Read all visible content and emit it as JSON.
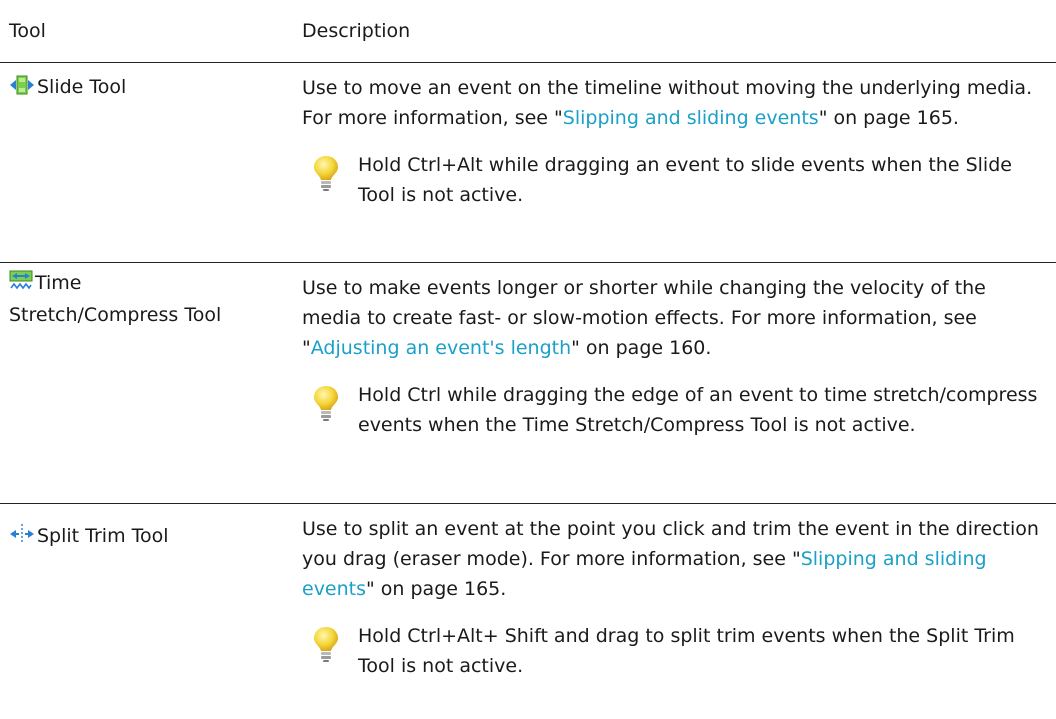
{
  "header": {
    "tool": "Tool",
    "description": "Description"
  },
  "rows": [
    {
      "tool_name": "Slide Tool",
      "icon": "slide-tool-icon",
      "desc_before": "Use to move an event on the timeline without moving the underlying media. For more information, see \"",
      "link_text": "Slipping and sliding events",
      "desc_after": "\" on page 165.",
      "tip": "Hold Ctrl+Alt while dragging an event to slide events when the Slide Tool is not active."
    },
    {
      "tool_name_line1": "Time",
      "tool_name_line2": "Stretch/Compress Tool",
      "icon": "time-stretch-tool-icon",
      "desc_before": "Use to make events longer or shorter while changing the velocity of the media to create fast- or slow-motion effects. For more information, see \"",
      "link_text": "Adjusting an event's length",
      "desc_after": "\" on page 160.",
      "tip": "Hold Ctrl while dragging the edge of an event to time stretch/compress events when the Time Stretch/Compress Tool is not active."
    },
    {
      "tool_name": "Split Trim Tool",
      "icon": "split-trim-tool-icon",
      "desc_before": "Use to split an event at the point you click and trim the event in the direction you drag (eraser mode). For more information, see \"",
      "link_text": "Slipping and sliding events",
      "desc_after": "\" on page 165.",
      "tip": "Hold Ctrl+Alt+ Shift and drag to split trim events when the Split Trim Tool is not active."
    }
  ],
  "colors": {
    "link": "#1aa0c9",
    "text": "#1a1a1a",
    "bulb": "#f5d63a"
  }
}
